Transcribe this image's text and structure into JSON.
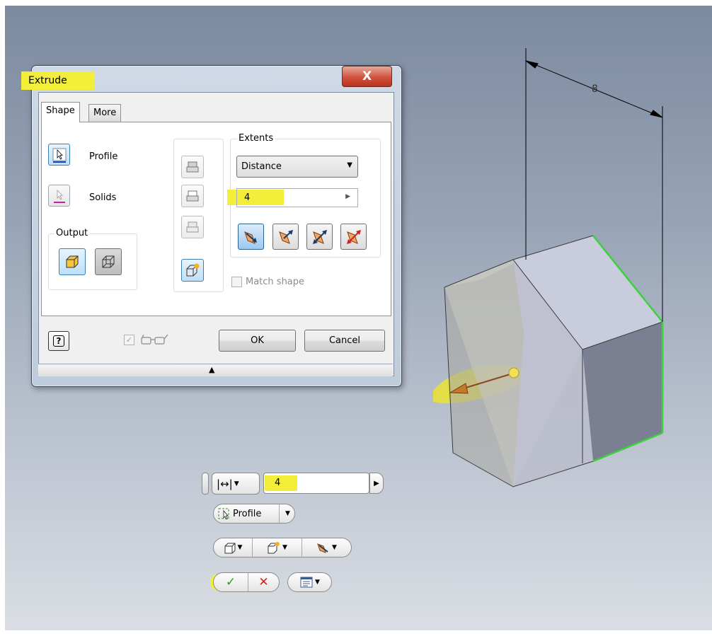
{
  "dialog": {
    "title": "Extrude",
    "close_label": "X",
    "tabs": [
      {
        "label": "Shape"
      },
      {
        "label": "More"
      }
    ],
    "profile_label": "Profile",
    "solids_label": "Solids",
    "output_caption": "Output",
    "extents_caption": "Extents",
    "extents_type": "Distance",
    "distance_value": "4",
    "match_shape_label": "Match shape",
    "ok_label": "OK",
    "cancel_label": "Cancel",
    "help_label": "?"
  },
  "model": {
    "dimension_label": "8"
  },
  "minitoolbar": {
    "distance_value": "4",
    "profile_label": "Profile"
  },
  "colors": {
    "highlight": "#f2ee3a",
    "selected_edge": "#3ad23a",
    "accent_blue": "#3c7fb1",
    "cancel_red": "#d22020",
    "ok_green": "#2e9a1e"
  }
}
